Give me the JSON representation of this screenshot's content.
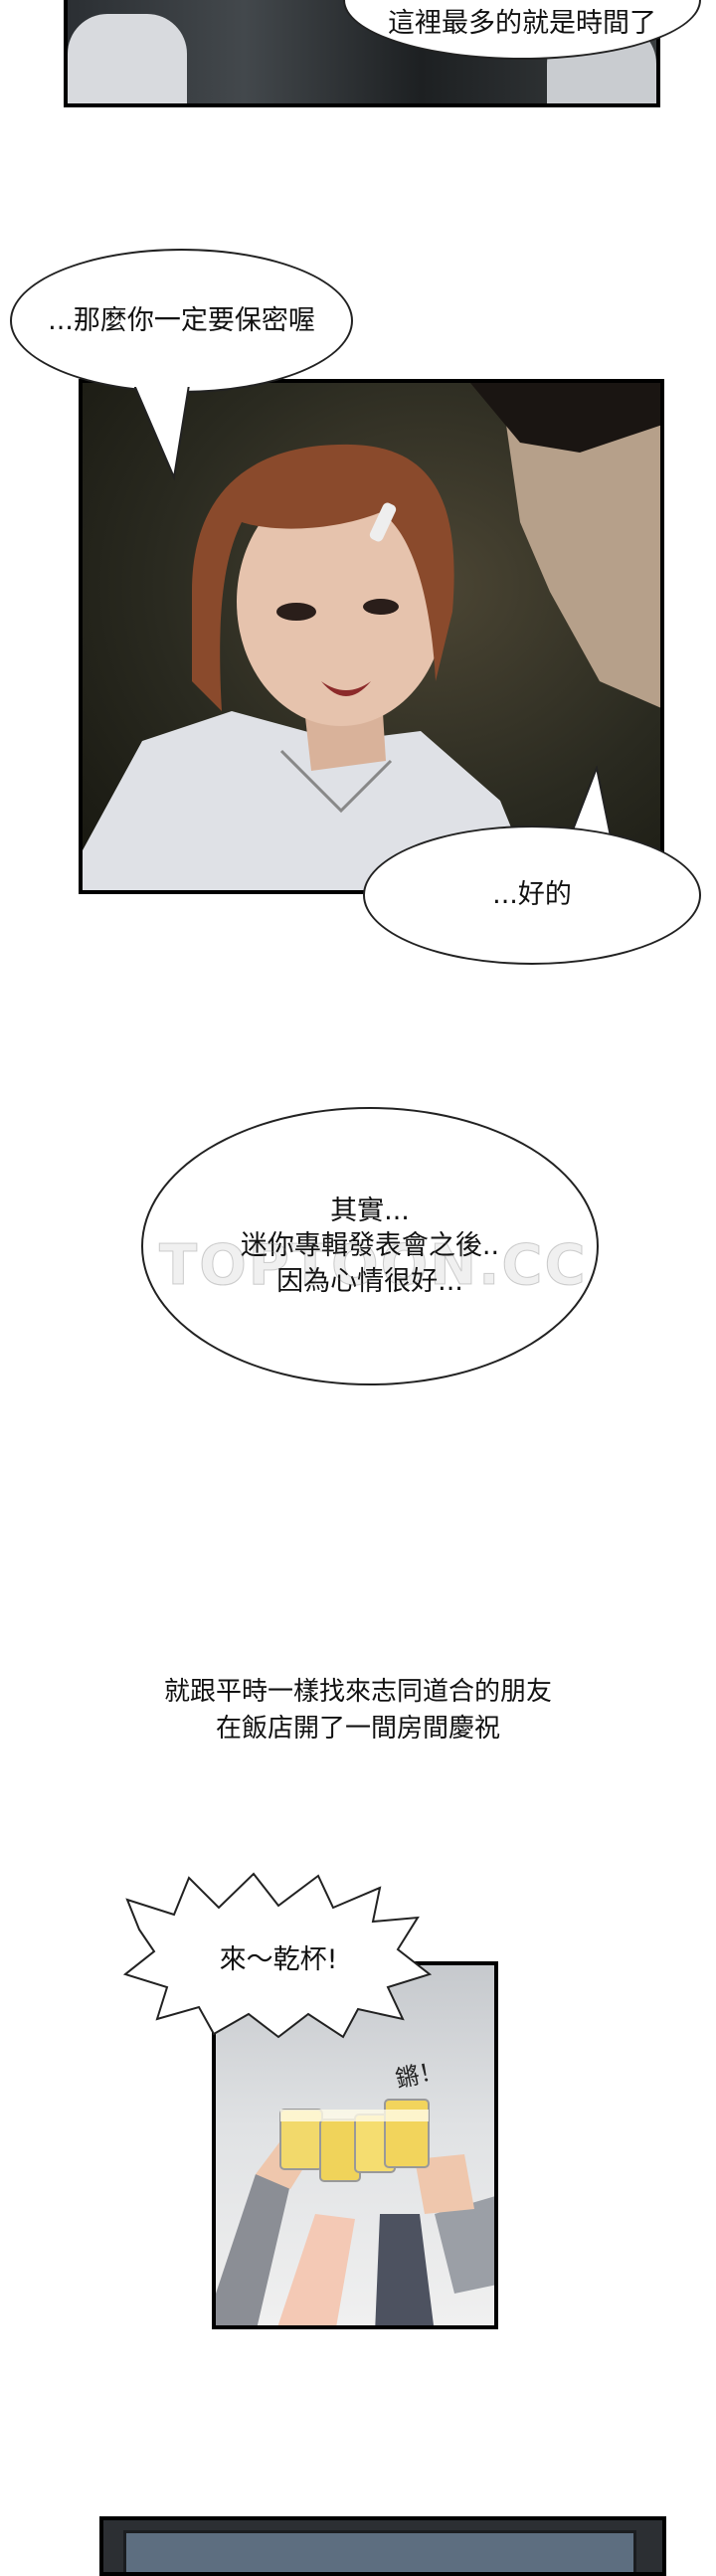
{
  "bubbles": {
    "top_partial": "這裡最多的就是時間了",
    "keep_secret": "...那麼你一定要保密喔",
    "okay": "...好的",
    "actually": "其實...\n迷你專輯發表會之後..\n因為心情很好...",
    "cheers": "來～乾杯!"
  },
  "caption": "就跟平時一樣找來志同道合的朋友\n在飯店開了一間房間慶祝",
  "sfx": "鏘！",
  "watermark": "TOPTOON.CC"
}
